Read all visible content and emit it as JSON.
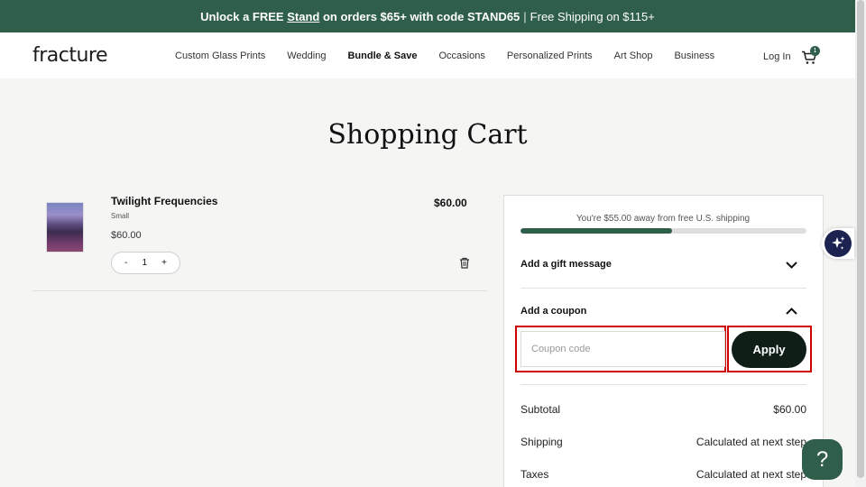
{
  "promo": {
    "lead": "Unlock a FREE",
    "link": "Stand",
    "tail": "on orders $65+ with code STAND65",
    "separator": "|",
    "shipping": "Free Shipping on $115+"
  },
  "header": {
    "logo": "fracture",
    "nav": [
      "Custom Glass Prints",
      "Wedding",
      "Bundle & Save",
      "Occasions",
      "Personalized Prints",
      "Art Shop",
      "Business"
    ],
    "login": "Log In",
    "cart_count": "1"
  },
  "page_title": "Shopping Cart",
  "cart_item": {
    "name": "Twilight Frequencies",
    "variant": "Small",
    "unit_price": "$60.00",
    "line_total": "$60.00",
    "qty_minus": "-",
    "quantity": "1",
    "qty_plus": "+"
  },
  "summary": {
    "shipping_message": "You're $55.00 away from free U.S. shipping",
    "shipping_progress": 0.53,
    "gift_message_label": "Add a gift message",
    "coupon_label": "Add a coupon",
    "coupon_placeholder": "Coupon code",
    "apply_label": "Apply",
    "subtotal_label": "Subtotal",
    "subtotal_value": "$60.00",
    "shipping_label": "Shipping",
    "shipping_value": "Calculated at next step",
    "taxes_label": "Taxes",
    "taxes_value": "Calculated at next step"
  },
  "help_label": "?",
  "colors": {
    "brand_green": "#2f5f4a",
    "apply_button": "#0f1f18",
    "highlight_red": "#d00000",
    "ai_badge": "#1c2350"
  }
}
